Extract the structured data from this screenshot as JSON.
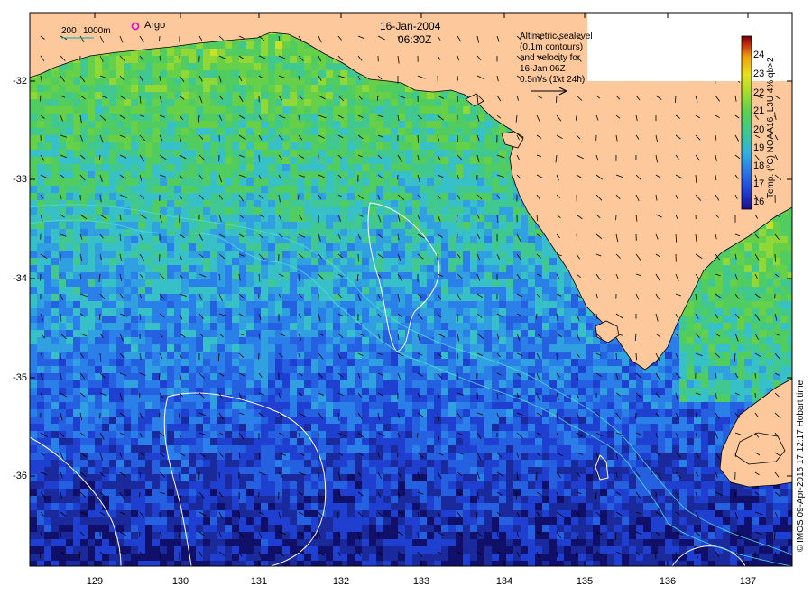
{
  "header": {
    "date": "16-Jan-2004",
    "time": "06:30Z"
  },
  "scale_bar": {
    "label_short": "200",
    "label_long": "1000m"
  },
  "argo": {
    "label": "Argo",
    "icon": "circle-marker-icon",
    "color": "#e000e0"
  },
  "annotation": {
    "lines": [
      "Altimetric sealevel",
      "(0.1m contours)",
      "and velocity for",
      "16-Jan 06Z",
      "0.5m/s (1kt 24h)"
    ],
    "arrow_icon": "right-arrow-icon"
  },
  "axes": {
    "y_ticks": [
      "-32",
      "-33",
      "-34",
      "-35",
      "-36"
    ],
    "x_ticks": [
      "129",
      "130",
      "131",
      "132",
      "133",
      "134",
      "135",
      "136",
      "137"
    ],
    "y_values": [
      -32,
      -33,
      -34,
      -35,
      -36
    ],
    "x_values": [
      129,
      130,
      131,
      132,
      133,
      134,
      135,
      136,
      137
    ],
    "lon_range": [
      128.2,
      137.5
    ],
    "lat_range": [
      -31.2,
      -36.9
    ]
  },
  "colorbar": {
    "title": "Temp. (°C) NOAA16_L3U 4% qb>2",
    "ticks": [
      "24",
      "23",
      "22",
      "21",
      "20",
      "19",
      "18",
      "17",
      "16"
    ],
    "range": [
      16,
      24.4
    ],
    "colors": [
      "#1a0d8a",
      "#1f3fd0",
      "#2a78e8",
      "#30b0e0",
      "#40c890",
      "#5ad050",
      "#a8dc30",
      "#e8e020",
      "#f0a010",
      "#c03010",
      "#700000"
    ]
  },
  "credit": "© IMOS 09-Apr-2015 17:12:17 Hobart time",
  "colors": {
    "land": "#fcc89c",
    "coast": "#000000",
    "contour": "#ffffff",
    "isobath": "#50d8e0"
  }
}
